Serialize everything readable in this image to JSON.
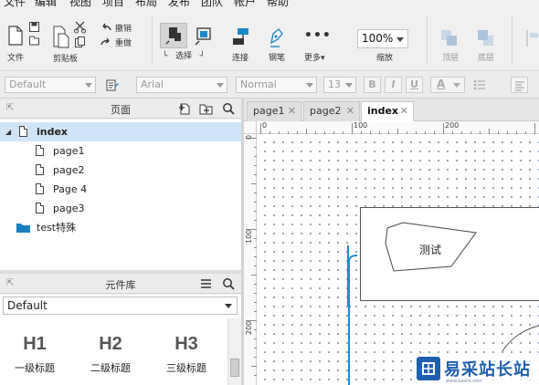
{
  "menu": [
    "文件",
    "编辑",
    "视图",
    "项目",
    "布局",
    "发布",
    "团队",
    "帐户",
    "帮助"
  ],
  "toolbar": {
    "file_label": "文件",
    "clipboard_label": "剪贴板",
    "undo_label": "撤销",
    "redo_label": "重做",
    "select_label": "选择",
    "connect_label": "连接",
    "pen_label": "钢笔",
    "more_label": "更多▾",
    "zoom_value": "100%",
    "zoom_label": "缩放",
    "top_label": "顶层",
    "bottom_label": "底层"
  },
  "format": {
    "style": "Default",
    "font": "Arial",
    "weight": "Normal",
    "size": "13",
    "bold": "B",
    "italic": "I",
    "underline": "U",
    "color": "A"
  },
  "pages_panel": {
    "title": "页面",
    "root": "index",
    "children": [
      "page1",
      "page2",
      "Page 4",
      "page3"
    ],
    "folder": "test特殊"
  },
  "library_panel": {
    "title": "元件库",
    "selected": "Default",
    "widgets": [
      {
        "glyph": "H1",
        "label": "一级标题"
      },
      {
        "glyph": "H2",
        "label": "二级标题"
      },
      {
        "glyph": "H3",
        "label": "三级标题"
      }
    ]
  },
  "tabs": [
    {
      "label": "page1",
      "active": false
    },
    {
      "label": "page2",
      "active": false
    },
    {
      "label": "index",
      "active": true
    }
  ],
  "ruler": {
    "top": [
      "0",
      "100",
      "200"
    ],
    "left": [
      "0",
      "100",
      "200"
    ]
  },
  "canvas": {
    "shape_text": "测试"
  },
  "watermark": {
    "text": "易采站长站",
    "sub": "www.easck.com"
  },
  "colors": {
    "selection": "#cfe5f7",
    "accent": "#1f87c8",
    "folder": "#1a7fc1",
    "connector": "#1c8fcf"
  }
}
